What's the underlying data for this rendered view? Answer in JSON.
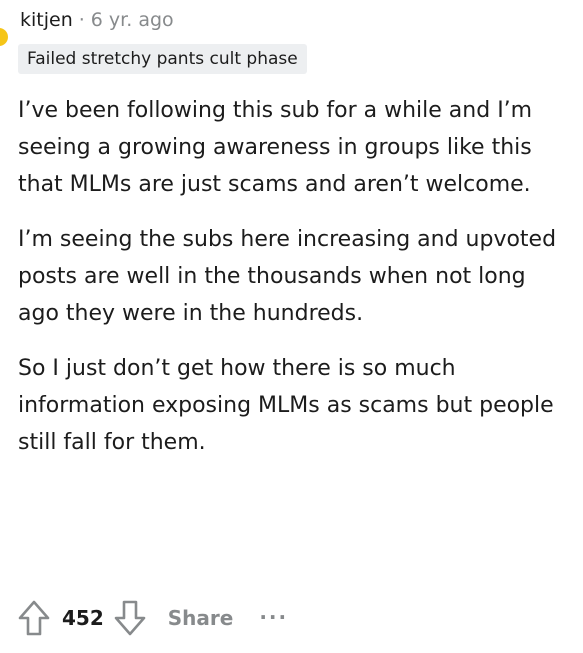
{
  "comment": {
    "username": "kitjen",
    "separator": "·",
    "timestamp": "6 yr. ago",
    "flair": "Failed stretchy pants cult phase",
    "paragraphs": [
      "I’ve been following this sub for a while and I’m seeing a growing awareness in groups like this that MLMs are just scams and aren’t welcome.",
      "I’m seeing the subs here increasing and upvoted posts are well in the thousands when not long ago they were in the hundreds.",
      "So I just don’t get how there is so much information exposing MLMs as scams but people still fall for them."
    ]
  },
  "actions": {
    "score": "452",
    "share_label": "Share",
    "more_label": "...",
    "upvote_icon": "upvote-arrow-icon",
    "downvote_icon": "downvote-arrow-icon"
  },
  "colors": {
    "text": "#1c1c1c",
    "meta": "#878a8c",
    "flair_bg": "#edeff1"
  }
}
